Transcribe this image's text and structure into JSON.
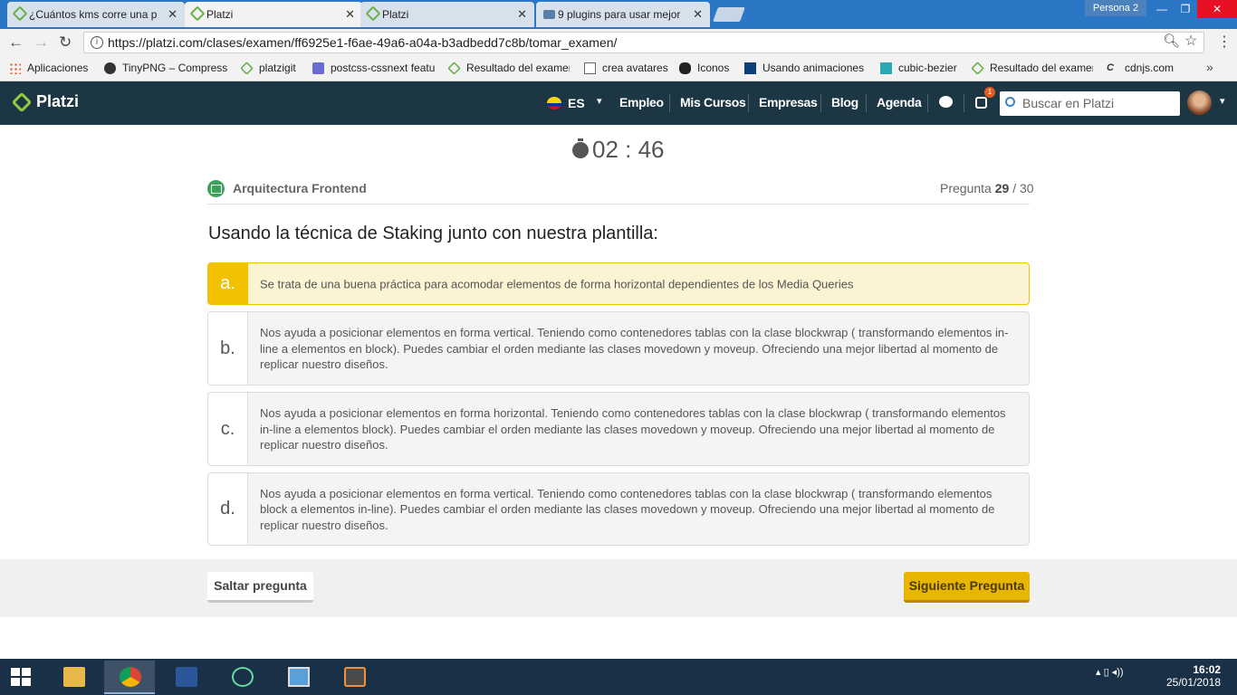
{
  "browser": {
    "tabs": [
      {
        "label": "¿Cuántos kms corre una p",
        "active": false
      },
      {
        "label": "Platzi",
        "active": true
      },
      {
        "label": "Platzi",
        "active": false
      },
      {
        "label": "9 plugins para usar mejor",
        "active": false
      }
    ],
    "profile": "Persona 2",
    "url": "https://platzi.com/clases/examen/ff6925e1-f6ae-49a6-a04a-b3adbedd7c8b/tomar_examen/",
    "bookmarks": [
      "Aplicaciones",
      "TinyPNG – Compress",
      "platzigit",
      "postcss-cssnext featu",
      "Resultado del examen",
      "crea avatares",
      "Iconos",
      "Usando animaciones",
      "cubic-bezier",
      "Resultado del examen",
      "cdnjs.com"
    ]
  },
  "platzi": {
    "logo": "Platzi",
    "lang": "ES",
    "nav": [
      "Empleo",
      "Mis Cursos",
      "Empresas",
      "Blog",
      "Agenda"
    ],
    "notifications": "1",
    "search_placeholder": "Buscar en Platzi"
  },
  "exam": {
    "timer": "02 : 46",
    "course": "Arquitectura Frontend",
    "progress_label": "Pregunta",
    "current": "29",
    "total": "/ 30",
    "question": "Usando la técnica de Staking junto con nuestra plantilla:",
    "options": [
      {
        "letter": "a.",
        "text": "Se trata de una buena práctica para acomodar elementos de forma horizontal dependientes de los Media Queries",
        "selected": true
      },
      {
        "letter": "b.",
        "text": "Nos ayuda a posicionar elementos en forma vertical. Teniendo como contenedores tablas con la clase blockwrap ( transformando elementos in-line a elementos en block). Puedes cambiar el orden mediante las clases movedown y moveup. Ofreciendo una mejor libertad al momento de replicar nuestro diseños.",
        "selected": false
      },
      {
        "letter": "c.",
        "text": "Nos ayuda a posicionar elementos en forma horizontal. Teniendo como contenedores tablas con la clase blockwrap ( transformando elementos in-line a elementos block). Puedes cambiar el orden mediante las clases movedown y moveup. Ofreciendo una mejor libertad al momento de replicar nuestro diseños.",
        "selected": false
      },
      {
        "letter": "d.",
        "text": "Nos ayuda a posicionar elementos en forma vertical. Teniendo como contenedores tablas con la clase blockwrap ( transformando elementos block a elementos in-line). Puedes cambiar el orden mediante las clases movedown y moveup. Ofreciendo una mejor libertad al momento de replicar nuestro diseños.",
        "selected": false
      }
    ],
    "skip_label": "Saltar pregunta",
    "next_label": "Siguiente Pregunta"
  },
  "taskbar": {
    "time": "16:02",
    "date": "25/01/2018"
  },
  "colors": {
    "header_bg": "#1c3644",
    "accent": "#98ca3f",
    "selected": "#f2c200",
    "next_button": "#e8b500"
  }
}
